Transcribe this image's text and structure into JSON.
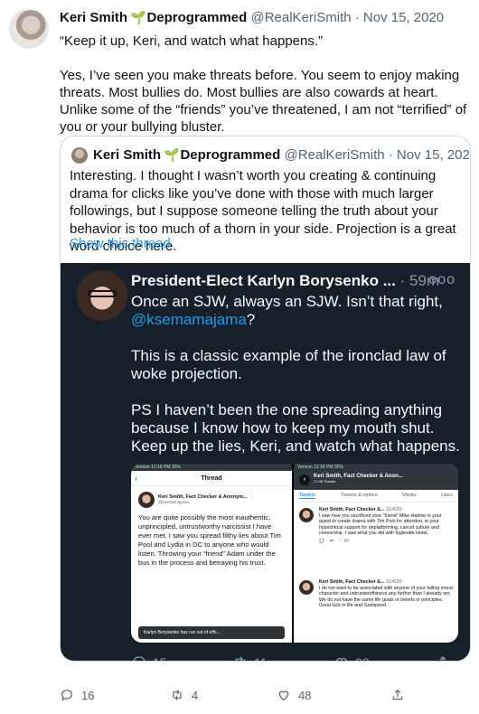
{
  "tweet": {
    "author_name": "Keri Smith",
    "author_suffix": "Deprogrammed",
    "handle": "@RealKeriSmith",
    "date": "Nov 15, 2020",
    "paragraphs": [
      "“Keep it up, Keri, and watch what happens.”",
      "Yes, I’ve seen you make threats before. You seem to enjoy making threats. Most bullies do. Most bullies are also cowards at heart. Unlike some of the “friends” you’ve threatened, I am not “terrified” of you or your bullying bluster."
    ],
    "counts": {
      "replies": "16",
      "retweets": "4",
      "likes": "48"
    }
  },
  "quoted": {
    "author_name": "Keri Smith",
    "author_suffix": "Deprogrammed",
    "handle": "@RealKeriSmith",
    "date": "Nov 15, 2020",
    "text": "Interesting. I thought I wasn’t worth you creating & continuing drama for clicks like you’ve done with those with much larger followings, but I suppose someone telling the truth about your behavior is too much of a thorn in your side. Projection is a great word choice here.",
    "show_thread": "Show this thread"
  },
  "embedded": {
    "author_name": "President-Elect Karlyn Borysenko ...",
    "time": "59m",
    "line1": "Once an SJW, always an SJW. Isn’t that right,",
    "mention": "@ksemamajama",
    "line1_end": "?",
    "para2": "This is a classic example of the ironclad law of woke projection.",
    "para3": "PS I haven’t been the one spreading anything because I know how to keep my mouth shut. Keep up the lies, Keri, and watch what happens.",
    "counts": {
      "replies": "15",
      "retweets": "11",
      "likes": "83"
    }
  },
  "screenshot_left": {
    "status_carrier": "Verizon",
    "status_time": "12:16 PM",
    "status_batt": "35%",
    "title": "Thread",
    "name": "Keri Smith, Fact Checker & Anonym...",
    "handle": "@ksemamajama",
    "text": "You are quite possibly the most inauthentic, unprincipled, untrustworthy narcissist I have ever met. I saw you spread filthy lies about Tim Pool and Lydia in DC to anyone who would listen. Throwing your “friend” Adam under the bus in the process and betraying his trust.",
    "footer": "Karlyn Borysenko has run out of effs..."
  },
  "screenshot_right": {
    "status_carrier": "Verizon",
    "status_time": "12:16 PM",
    "status_batt": "35%",
    "header_name": "Keri Smith, Fact Checker & Anon...",
    "header_sub": "17.4K Tweets",
    "tabs": [
      "Tweets",
      "Tweets & replies",
      "Media",
      "Likes"
    ],
    "tweets": [
      {
        "name": "Keri Smith, Fact Checker &...",
        "date": "11/4/20",
        "text": "I saw how you sacrificed your “friend” Mike Harlow in your quest to create drama with Tim Pool for attention, in your hypocritical support for deplatforming, cancel culture and censorship. I saw what you did with Ingleside Hotel.",
        "likes": "43"
      },
      {
        "name": "Keri Smith, Fact Checker &...",
        "date": "11/4/20",
        "text": "I do not want to be associated with anyone of your failing moral character and untrustworthiness any further than I already am. We do not have the same life goals or beliefs or principles. Good luck in life and Godspeed.",
        "likes": ""
      }
    ]
  }
}
